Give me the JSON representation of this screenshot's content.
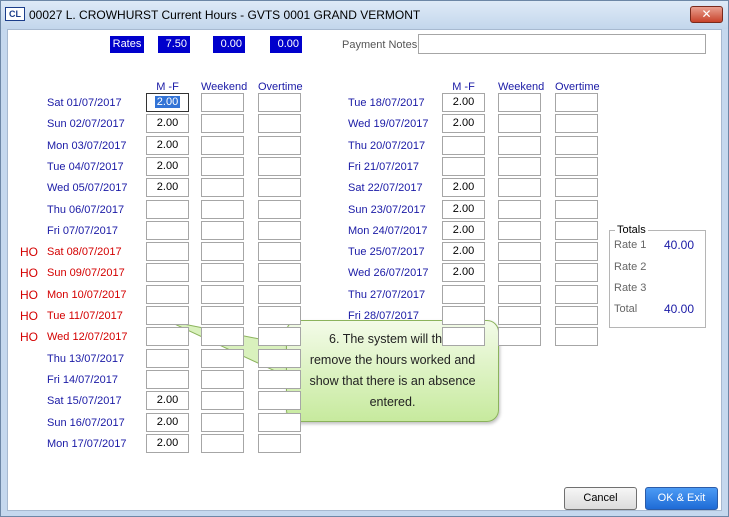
{
  "window": {
    "title": "00027 L. CROWHURST  Current Hours - GVTS 0001 GRAND VERMONT",
    "app_icon": "CL",
    "close_glyph": "✕"
  },
  "rates": {
    "label": "Rates",
    "values": [
      "7.50",
      "0.00",
      "0.00"
    ]
  },
  "payment_notes": {
    "label": "Payment Notes",
    "value": ""
  },
  "columns": [
    "M -F",
    "Weekend",
    "Overtime"
  ],
  "ho_tag": "HO",
  "left_days": [
    {
      "date": "Sat 01/07/2017",
      "ho": false,
      "mf": "2.00",
      "focused": true
    },
    {
      "date": "Sun 02/07/2017",
      "ho": false,
      "mf": "2.00"
    },
    {
      "date": "Mon 03/07/2017",
      "ho": false,
      "mf": "2.00"
    },
    {
      "date": "Tue 04/07/2017",
      "ho": false,
      "mf": "2.00"
    },
    {
      "date": "Wed 05/07/2017",
      "ho": false,
      "mf": "2.00"
    },
    {
      "date": "Thu 06/07/2017",
      "ho": false,
      "mf": ""
    },
    {
      "date": "Fri 07/07/2017",
      "ho": false,
      "mf": ""
    },
    {
      "date": "Sat 08/07/2017",
      "ho": true,
      "mf": ""
    },
    {
      "date": "Sun 09/07/2017",
      "ho": true,
      "mf": ""
    },
    {
      "date": "Mon 10/07/2017",
      "ho": true,
      "mf": ""
    },
    {
      "date": "Tue 11/07/2017",
      "ho": true,
      "mf": ""
    },
    {
      "date": "Wed 12/07/2017",
      "ho": true,
      "mf": ""
    },
    {
      "date": "Thu 13/07/2017",
      "ho": false,
      "mf": ""
    },
    {
      "date": "Fri 14/07/2017",
      "ho": false,
      "mf": ""
    },
    {
      "date": "Sat 15/07/2017",
      "ho": false,
      "mf": "2.00"
    },
    {
      "date": "Sun 16/07/2017",
      "ho": false,
      "mf": "2.00"
    },
    {
      "date": "Mon 17/07/2017",
      "ho": false,
      "mf": "2.00"
    }
  ],
  "right_days": [
    {
      "date": "Tue 18/07/2017",
      "mf": "2.00"
    },
    {
      "date": "Wed 19/07/2017",
      "mf": "2.00"
    },
    {
      "date": "Thu 20/07/2017",
      "mf": ""
    },
    {
      "date": "Fri 21/07/2017",
      "mf": ""
    },
    {
      "date": "Sat 22/07/2017",
      "mf": "2.00"
    },
    {
      "date": "Sun 23/07/2017",
      "mf": "2.00"
    },
    {
      "date": "Mon 24/07/2017",
      "mf": "2.00"
    },
    {
      "date": "Tue 25/07/2017",
      "mf": "2.00"
    },
    {
      "date": "Wed 26/07/2017",
      "mf": "2.00"
    },
    {
      "date": "Thu 27/07/2017",
      "mf": ""
    },
    {
      "date": "Fri 28/07/2017",
      "mf": ""
    }
  ],
  "totals": {
    "title": "Totals",
    "rows": [
      {
        "label": "Rate 1",
        "value": "40.00"
      },
      {
        "label": "Rate 2",
        "value": ""
      },
      {
        "label": "Rate 3",
        "value": ""
      },
      {
        "label": "Total",
        "value": "40.00"
      }
    ]
  },
  "callout": {
    "lines": [
      "6. The system will then",
      "remove the hours worked and",
      "show that there is an absence",
      "entered."
    ]
  },
  "buttons": {
    "cancel": "Cancel",
    "ok": "OK & Exit"
  }
}
